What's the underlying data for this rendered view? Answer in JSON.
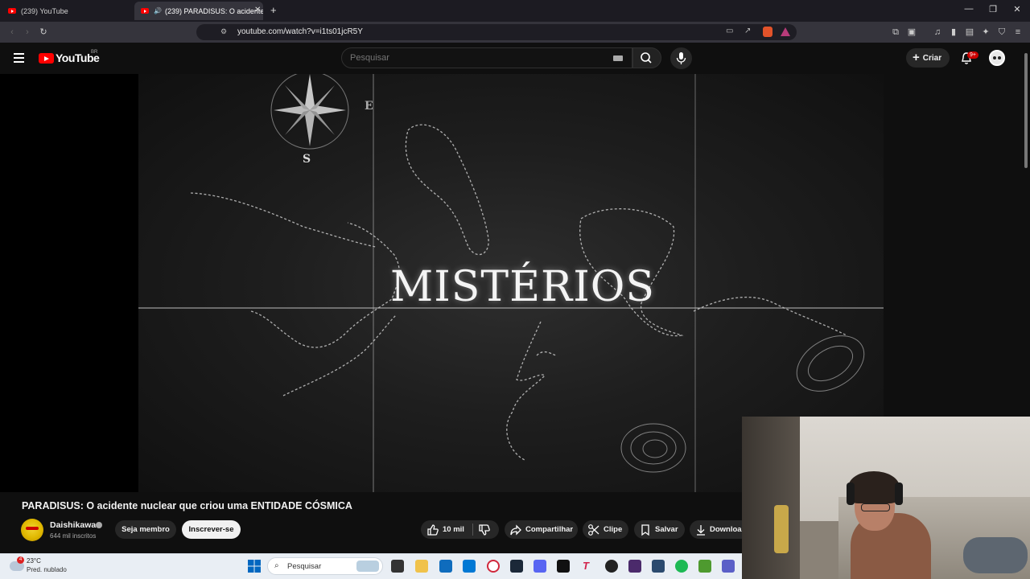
{
  "browser": {
    "tabs": [
      {
        "label": "(239) YouTube"
      },
      {
        "label": "(239) PARADISUS: O acidente"
      }
    ],
    "new_tab": "+",
    "url": "youtube.com/watch?v=i1ts01jcR5Y"
  },
  "masthead": {
    "logo_text": "YouTube",
    "country": "BR",
    "search_placeholder": "Pesquisar",
    "create_label": "Criar",
    "notifications_badge": "9+"
  },
  "video": {
    "overlay_text": "MISTÉRIOS",
    "compass_letters": [
      "S",
      "E"
    ],
    "title": "PARADISUS: O acidente nuclear que criou uma ENTIDADE CÓSMICA"
  },
  "channel": {
    "name": "Daishikawa",
    "subscribers": "644 mil inscritos",
    "member_label": "Seja membro",
    "subscribe_label": "Inscrever-se"
  },
  "actions": {
    "likes": "10 mil",
    "share": "Compartilhar",
    "clip": "Clipe",
    "save": "Salvar",
    "download": "Download"
  },
  "taskbar": {
    "weather_badge": "4",
    "temperature": "23°C",
    "weather_desc": "Pred. nublado",
    "search_label": "Pesquisar",
    "accent": "#0067c0"
  }
}
